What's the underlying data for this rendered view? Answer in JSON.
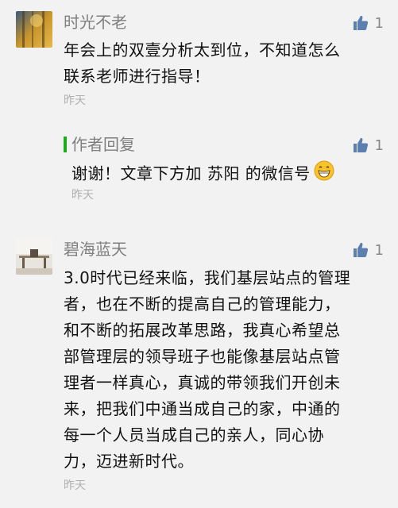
{
  "comments": [
    {
      "nickname": "时光不老",
      "content_lines": [
        "年会上的双壹分析太到位，不知道怎么",
        "联系老师进行指导！"
      ],
      "time": "昨天",
      "likes": "1",
      "avatar_icon": "golden-forest-avatar"
    },
    {
      "nickname": "碧海蓝天",
      "content_lines": [
        "3.0时代已经来临，我们基层站点的管理",
        "者，也在不断的提高自己的管理能力，",
        "和不断的拓展改革思路，我真心希望总",
        "部管理层的领导班子也能像基层站点管",
        "理者一样真心，真诚的带领我们开创未",
        "来，把我们中通当成自己的家，中通的",
        "每一个人员当成自己的亲人，同心协",
        "力，迈进新时代。"
      ],
      "time": "昨天",
      "likes": "1",
      "avatar_icon": "room-photo-avatar"
    }
  ],
  "author_reply": {
    "label": "作者回复",
    "content": "谢谢！文章下方加 苏阳 的微信号",
    "emoji": "grinning-face-emoji",
    "time": "昨天",
    "likes": "1"
  },
  "colors": {
    "accent": "#1aad19",
    "like_icon": "#5b7fae",
    "meta": "#b0b0b0"
  }
}
